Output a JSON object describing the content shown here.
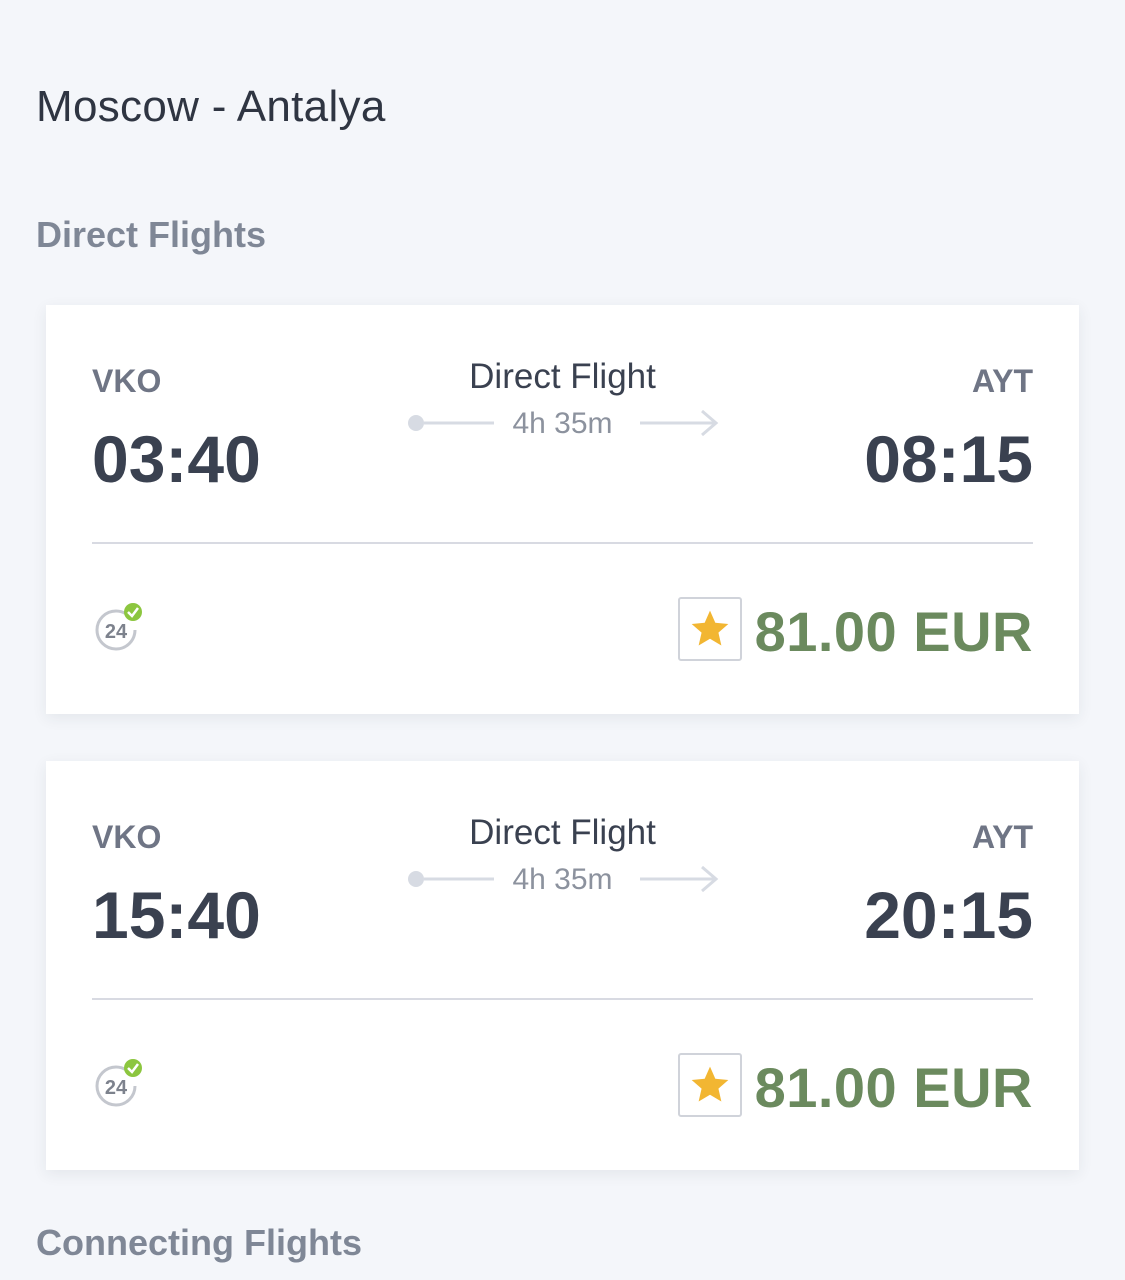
{
  "header": {
    "route": "Moscow - Antalya"
  },
  "sections": {
    "direct": "Direct Flights",
    "connecting": "Connecting Flights"
  },
  "flights": [
    {
      "from": "VKO",
      "to": "AYT",
      "departure": "03:40",
      "arrival": "08:15",
      "type": "Direct Flight",
      "duration": "4h 35m",
      "badge_icon": "24h-check-icon",
      "favorite_icon": "star-icon",
      "price": "81.00 EUR"
    },
    {
      "from": "VKO",
      "to": "AYT",
      "departure": "15:40",
      "arrival": "20:15",
      "type": "Direct Flight",
      "duration": "4h 35m",
      "badge_icon": "24h-check-icon",
      "favorite_icon": "star-icon",
      "price": "81.00 EUR"
    }
  ],
  "colors": {
    "price": "#6b8a5e",
    "star": "#f2b632",
    "check": "#8cc63f",
    "background": "#f4f6fa"
  }
}
